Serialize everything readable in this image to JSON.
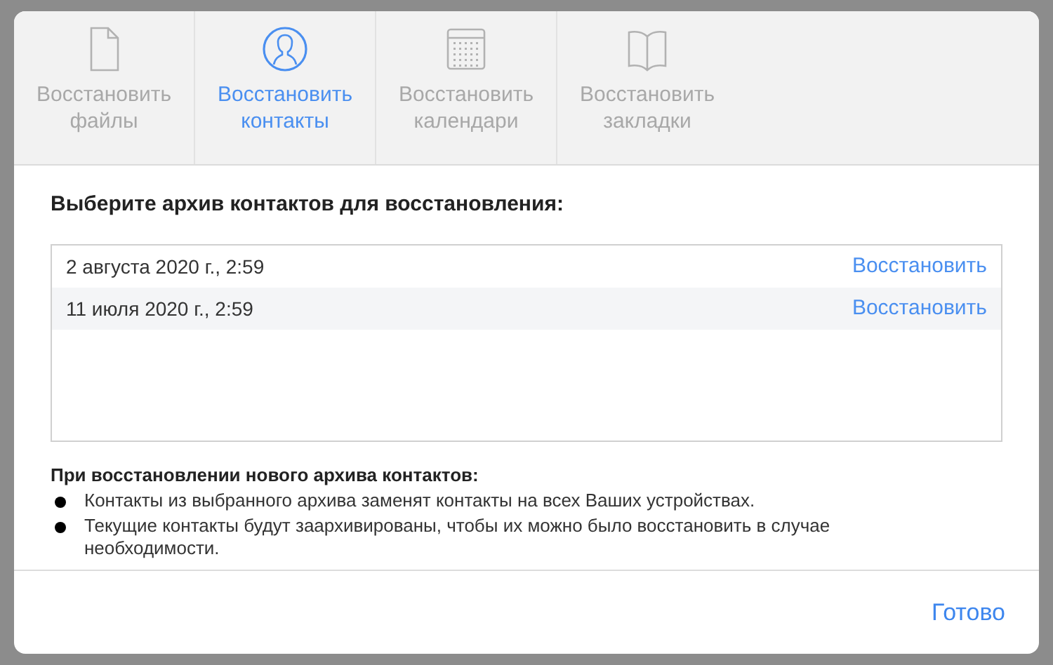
{
  "tabs": [
    {
      "label": "Восстановить файлы",
      "kind": "file",
      "selected": false
    },
    {
      "label": "Восстановить контакты",
      "kind": "contacts",
      "selected": true
    },
    {
      "label": "Восстановить календари",
      "kind": "calendar",
      "selected": false
    },
    {
      "label": "Восстановить закладки",
      "kind": "bookmarks",
      "selected": false
    }
  ],
  "heading": "Выберите архив контактов для восстановления:",
  "archives": [
    {
      "date": "2 августа 2020 г., 2:59",
      "action": "Восстановить"
    },
    {
      "date": "11 июля 2020 г., 2:59",
      "action": "Восстановить"
    }
  ],
  "notes": {
    "title": "При восстановлении нового архива контактов:",
    "items": [
      "Контакты из выбранного архива заменят контакты на всех Ваших устройствах.",
      "Текущие контакты будут заархивированы, чтобы их можно было восстановить в случае необходимости."
    ]
  },
  "done_button": "Готово"
}
